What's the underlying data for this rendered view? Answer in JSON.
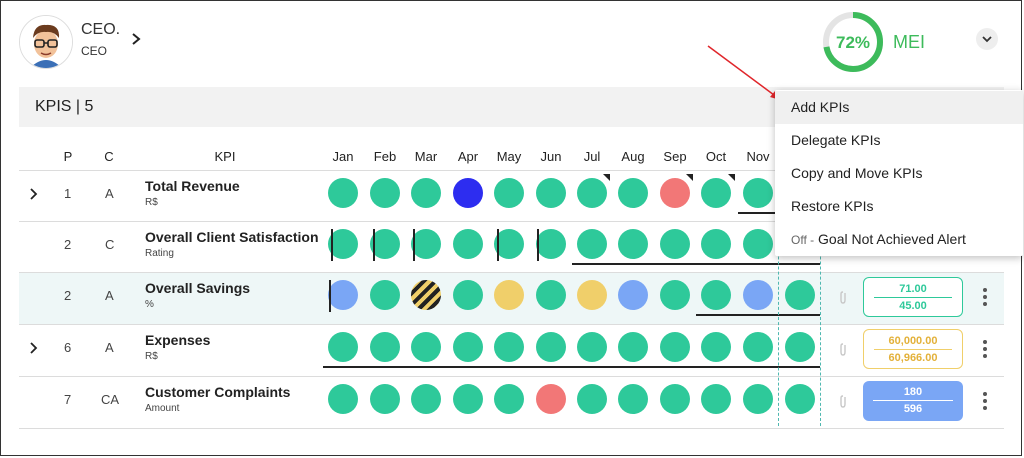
{
  "user": {
    "name": "CEO.",
    "role": "CEO"
  },
  "mei": {
    "percent": 72,
    "percent_label": "72%",
    "label": "MEI",
    "color": "#3dbb5b"
  },
  "kpi_section": {
    "title": "KPIS | 5"
  },
  "columns": {
    "p": "P",
    "c": "C",
    "kpi": "KPI",
    "months": [
      "Jan",
      "Feb",
      "Mar",
      "Apr",
      "May",
      "Jun",
      "Jul",
      "Aug",
      "Sep",
      "Oct",
      "Nov"
    ]
  },
  "colors": {
    "green": "#2ec99a",
    "blue": "#2d2df0",
    "lightblue": "#7aa6f5",
    "yellow": "#f0cf6a",
    "red": "#f27777"
  },
  "rows": [
    {
      "p": "1",
      "c": "A",
      "name": "Total Revenue",
      "unit": "R$",
      "expandable": true
    },
    {
      "p": "2",
      "c": "C",
      "name": "Overall Client Satisfaction",
      "unit": "Rating",
      "expandable": false
    },
    {
      "p": "2",
      "c": "A",
      "name": "Overall Savings",
      "unit": "%",
      "expandable": false,
      "result": {
        "v1": "71.00",
        "v2": "45.00"
      }
    },
    {
      "p": "6",
      "c": "A",
      "name": "Expenses",
      "unit": "R$",
      "expandable": true,
      "result": {
        "v1": "60,000.00",
        "v2": "60,966.00"
      }
    },
    {
      "p": "7",
      "c": "CA",
      "name": "Customer Complaints",
      "unit": "Amount",
      "expandable": false,
      "result": {
        "v1": "180",
        "v2": "596"
      }
    }
  ],
  "dots": [
    [
      "green",
      "green",
      "green",
      "blue",
      "green",
      "green",
      "green",
      "green",
      "red",
      "green",
      "green"
    ],
    [
      "green",
      "green",
      "green",
      "green",
      "green",
      "green",
      "green",
      "green",
      "green",
      "green",
      "green"
    ],
    [
      "lightblue",
      "green",
      "hatched",
      "green",
      "yellow",
      "green",
      "yellow",
      "lightblue",
      "green",
      "green",
      "lightblue",
      "green"
    ],
    [
      "green",
      "green",
      "green",
      "green",
      "green",
      "green",
      "green",
      "green",
      "green",
      "green",
      "green",
      "green"
    ],
    [
      "green",
      "green",
      "green",
      "green",
      "green",
      "red",
      "green",
      "green",
      "green",
      "green",
      "green",
      "green"
    ]
  ],
  "menu": {
    "items": [
      "Add KPIs",
      "Delegate KPIs",
      "Copy and Move KPIs",
      "Restore KPIs"
    ],
    "alert_state": "Off -",
    "alert_label": "Goal Not Achieved Alert"
  }
}
